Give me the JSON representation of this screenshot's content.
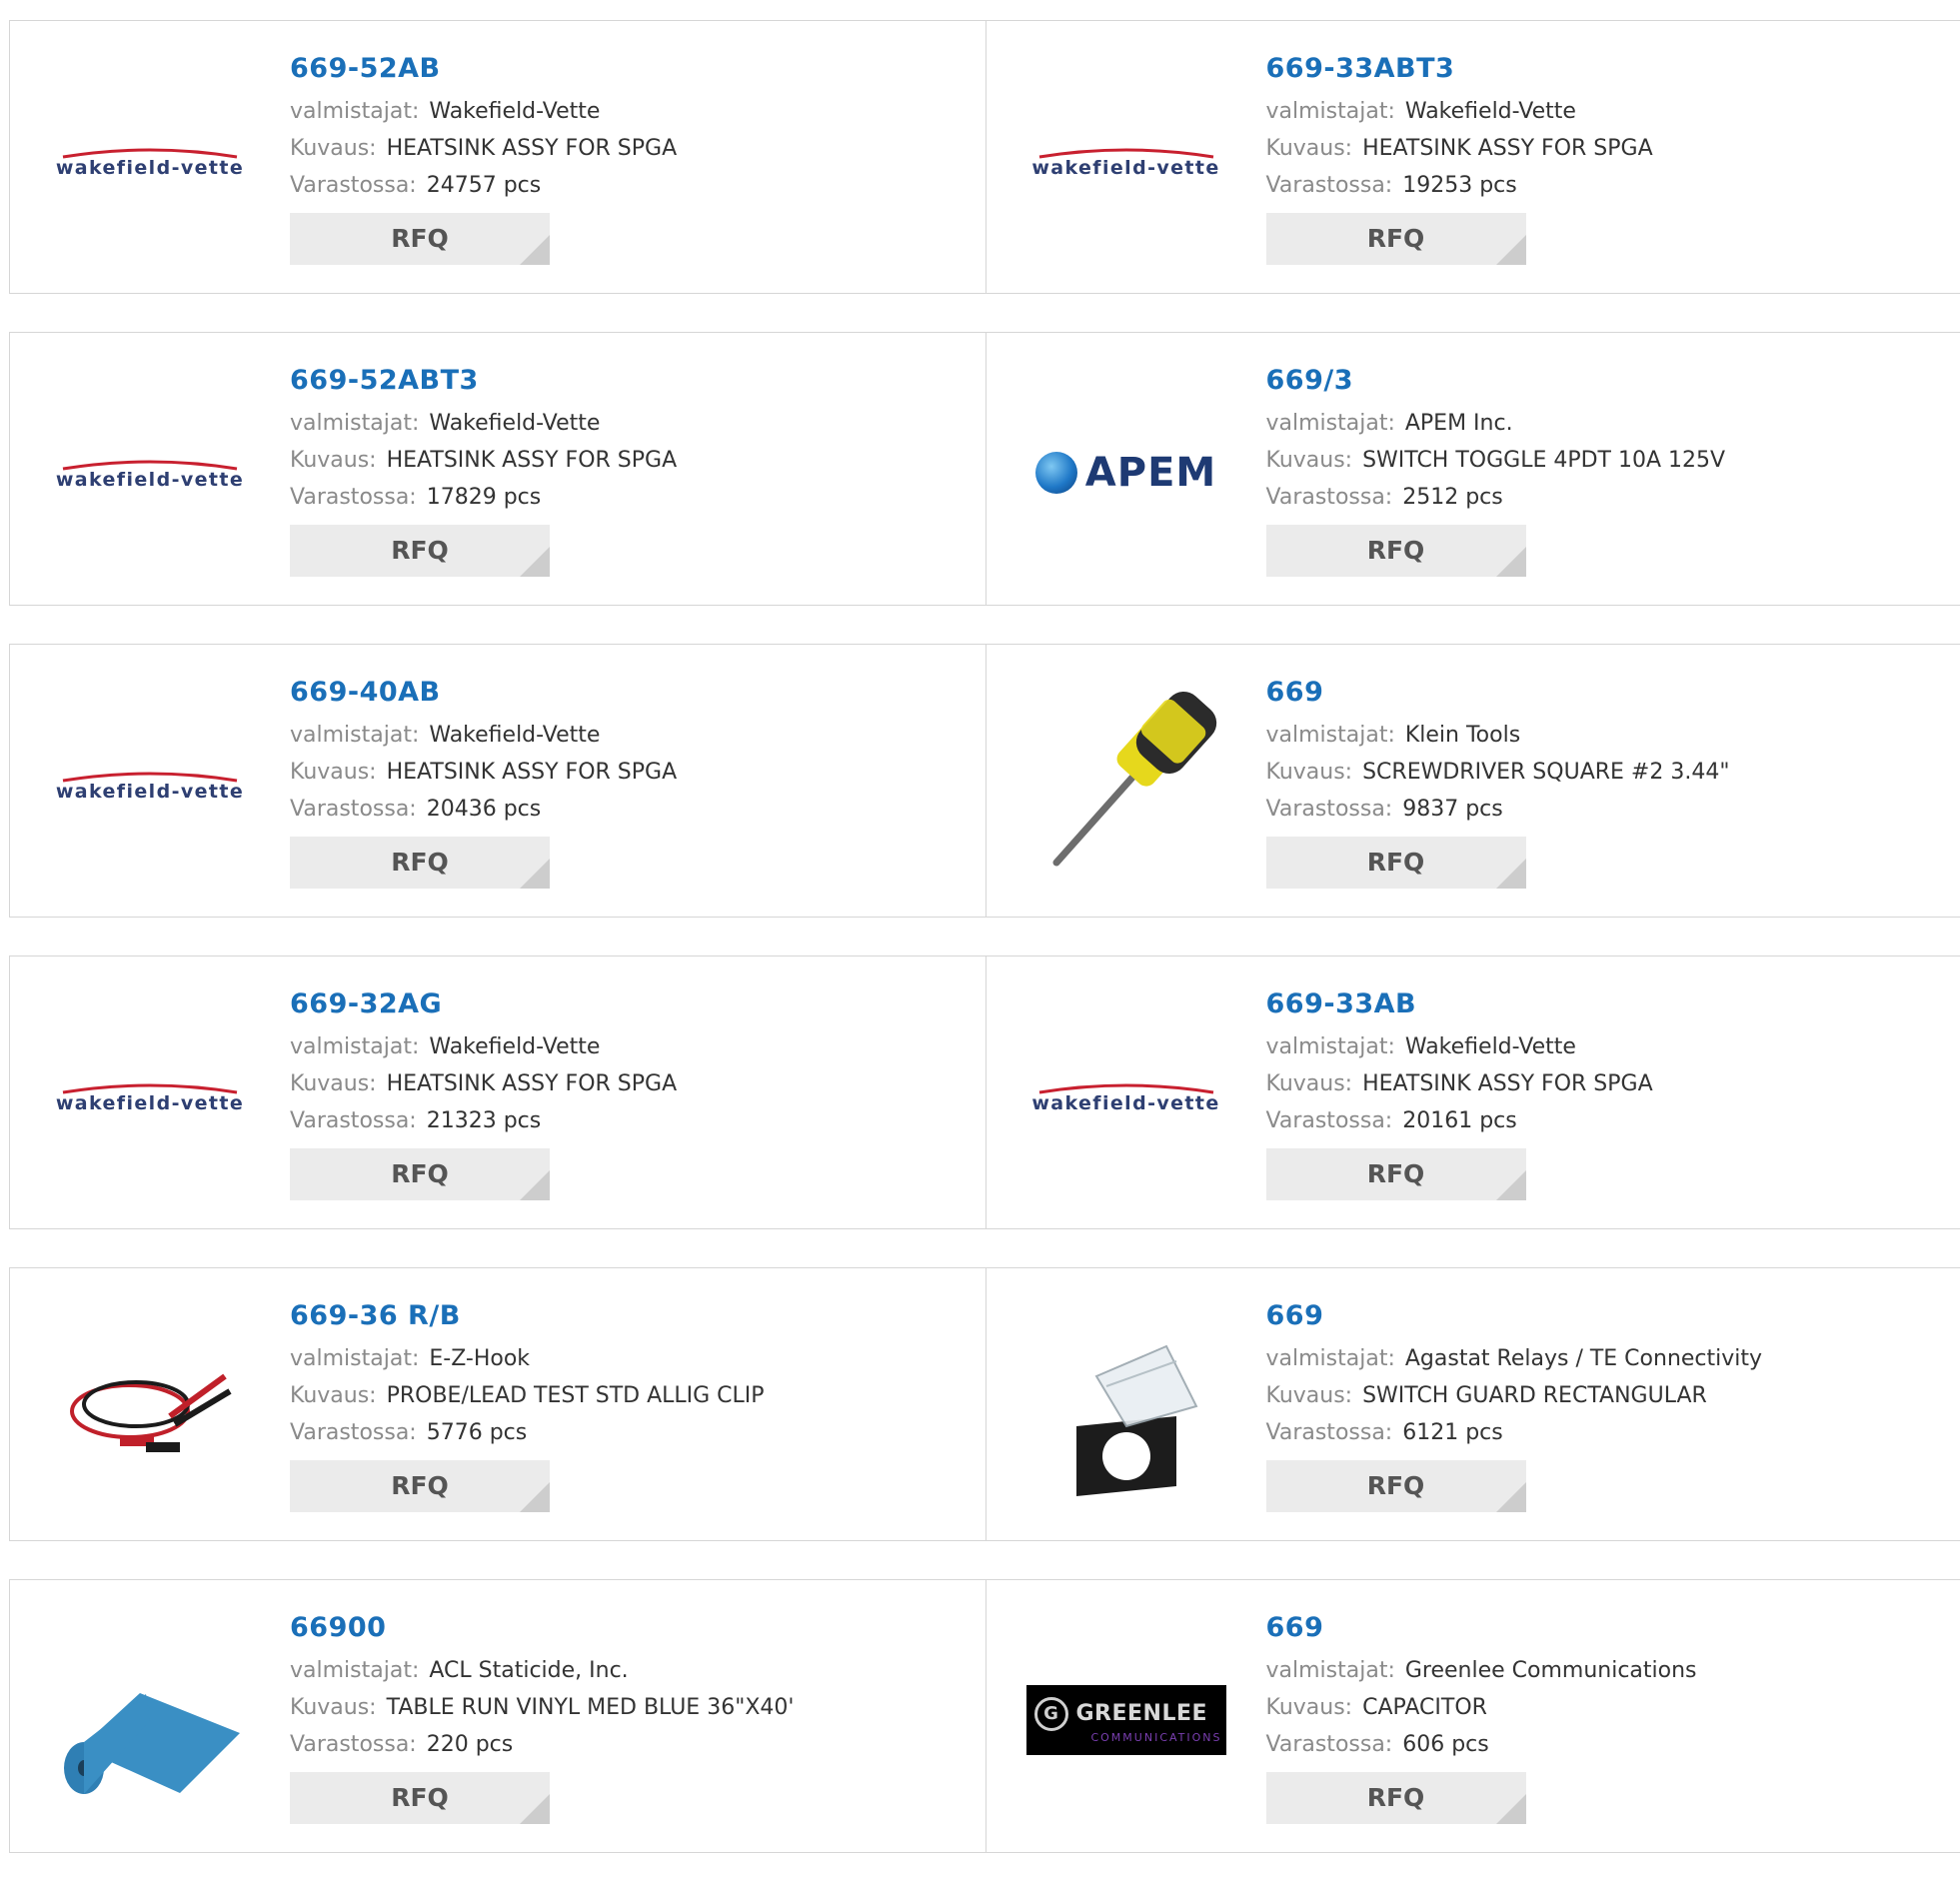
{
  "labels": {
    "manufacturer": "valmistajat:",
    "description": "Kuvaus:",
    "stock": "Varastossa:",
    "rfq": "RFQ"
  },
  "colors": {
    "part_link": "#1a6fb8",
    "label_gray": "#8a8a8a",
    "button_bg": "#ebebeb",
    "border": "#d6d6d6"
  },
  "products": [
    {
      "part": "669-52AB",
      "manufacturer": "Wakefield-Vette",
      "description": "HEATSINK ASSY FOR SPGA",
      "stock": "24757 pcs",
      "image": "wakefield-vette-logo"
    },
    {
      "part": "669-33ABT3",
      "manufacturer": "Wakefield-Vette",
      "description": "HEATSINK ASSY FOR SPGA",
      "stock": "19253 pcs",
      "image": "wakefield-vette-logo"
    },
    {
      "part": "669-52ABT3",
      "manufacturer": "Wakefield-Vette",
      "description": "HEATSINK ASSY FOR SPGA",
      "stock": "17829 pcs",
      "image": "wakefield-vette-logo"
    },
    {
      "part": "669/3",
      "manufacturer": "APEM Inc.",
      "description": "SWITCH TOGGLE 4PDT 10A 125V",
      "stock": "2512 pcs",
      "image": "apem-logo"
    },
    {
      "part": "669-40AB",
      "manufacturer": "Wakefield-Vette",
      "description": "HEATSINK ASSY FOR SPGA",
      "stock": "20436 pcs",
      "image": "wakefield-vette-logo"
    },
    {
      "part": "669",
      "manufacturer": "Klein Tools",
      "description": "SCREWDRIVER SQUARE #2 3.44\"",
      "stock": "9837 pcs",
      "image": "screwdriver-photo"
    },
    {
      "part": "669-32AG",
      "manufacturer": "Wakefield-Vette",
      "description": "HEATSINK ASSY FOR SPGA",
      "stock": "21323 pcs",
      "image": "wakefield-vette-logo"
    },
    {
      "part": "669-33AB",
      "manufacturer": "Wakefield-Vette",
      "description": "HEATSINK ASSY FOR SPGA",
      "stock": "20161 pcs",
      "image": "wakefield-vette-logo"
    },
    {
      "part": "669-36 R/B",
      "manufacturer": "E-Z-Hook",
      "description": "PROBE/LEAD TEST STD ALLIG CLIP",
      "stock": "5776 pcs",
      "image": "test-lead-photo"
    },
    {
      "part": "669",
      "manufacturer": "Agastat Relays / TE Connectivity",
      "description": "SWITCH GUARD RECTANGULAR",
      "stock": "6121 pcs",
      "image": "switch-guard-photo"
    },
    {
      "part": "66900",
      "manufacturer": "ACL Staticide, Inc.",
      "description": "TABLE RUN VINYL MED BLUE 36\"X40'",
      "stock": "220 pcs",
      "image": "vinyl-roll-photo"
    },
    {
      "part": "669",
      "manufacturer": "Greenlee Communications",
      "description": "CAPACITOR",
      "stock": "606 pcs",
      "image": "greenlee-logo"
    }
  ],
  "logos": {
    "wakefield": "wakefield-vette",
    "apem": "APEM",
    "greenlee_name": "GREENLEE",
    "greenlee_sub": "COMMUNICATIONS"
  }
}
